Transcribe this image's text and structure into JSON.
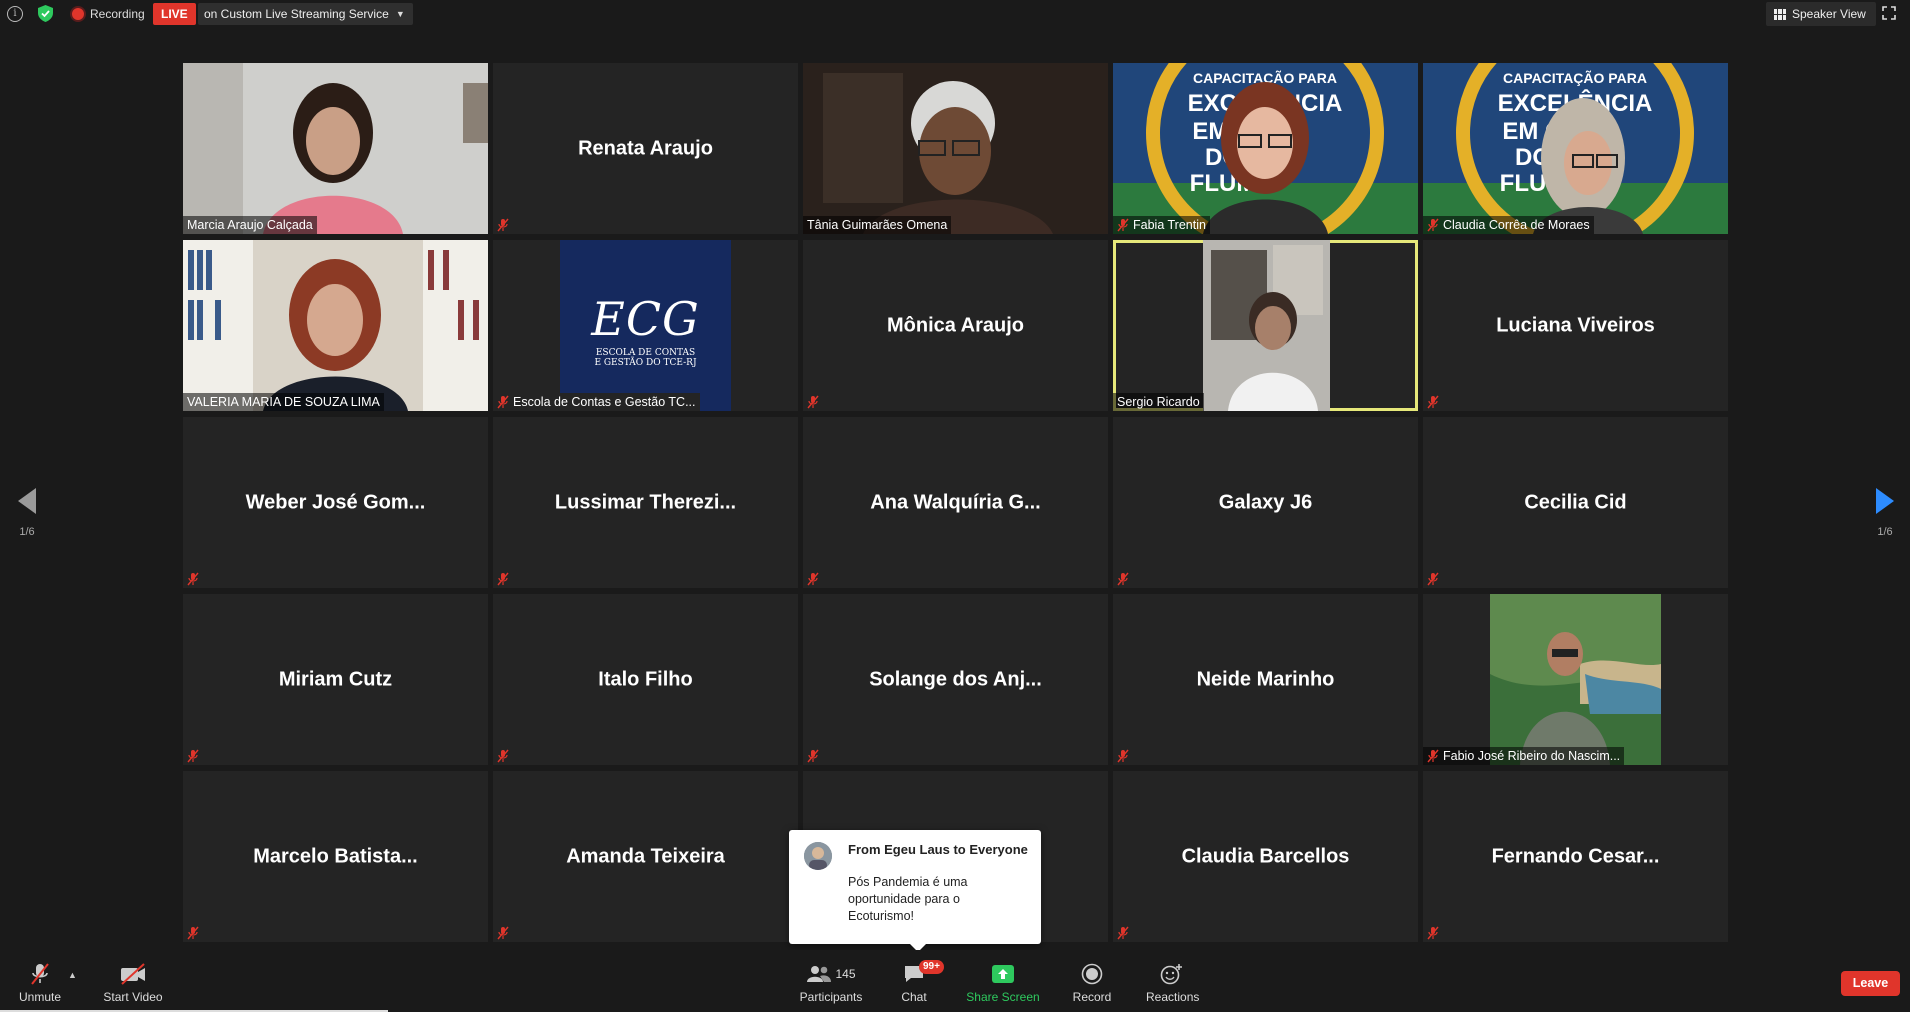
{
  "topbar": {
    "recording_label": "Recording",
    "live_label": "LIVE",
    "live_target": "on Custom Live Streaming Service",
    "speaker_view_label": "Speaker View"
  },
  "tiles": [
    {
      "name": "Marcia Araujo Calçada",
      "display": "video",
      "muted": false
    },
    {
      "name": "Renata Araujo",
      "display": "name",
      "muted": true
    },
    {
      "name": "Tânia Guimarães Omena",
      "display": "video",
      "muted": false
    },
    {
      "name": "Fabia Trentin",
      "display": "video",
      "muted": true
    },
    {
      "name": "Claudia Corrêa de Moraes",
      "display": "video",
      "muted": true
    },
    {
      "name": "VALERIA MARIA DE SOUZA LIMA",
      "display": "video",
      "muted": false
    },
    {
      "name": "Escola de Contas e Gestão TC...",
      "display": "logo",
      "muted": true
    },
    {
      "name": "Mônica Araujo",
      "display": "name",
      "muted": true
    },
    {
      "name": "Sergio Ricardo",
      "display": "video",
      "muted": false,
      "active": true
    },
    {
      "name": "Luciana Viveiros",
      "display": "name",
      "muted": true
    },
    {
      "name": "Weber José Gom...",
      "display": "name",
      "muted": true
    },
    {
      "name": "Lussimar Therezi...",
      "display": "name",
      "muted": true
    },
    {
      "name": "Ana Walquíria G...",
      "display": "name",
      "muted": true
    },
    {
      "name": "Galaxy J6",
      "display": "name",
      "muted": true
    },
    {
      "name": "Cecilia Cid",
      "display": "name",
      "muted": true
    },
    {
      "name": "Miriam Cutz",
      "display": "name",
      "muted": true
    },
    {
      "name": "Italo Filho",
      "display": "name",
      "muted": true
    },
    {
      "name": "Solange dos Anj...",
      "display": "name",
      "muted": true
    },
    {
      "name": "Neide Marinho",
      "display": "name",
      "muted": true
    },
    {
      "name": "Fabio José Ribeiro do Nascim...",
      "display": "video",
      "muted": true
    },
    {
      "name": "Marcelo Batista...",
      "display": "name",
      "muted": true
    },
    {
      "name": "Amanda Teixeira",
      "display": "name",
      "muted": true
    },
    {
      "name": "",
      "display": "name",
      "muted": false
    },
    {
      "name": "Claudia Barcellos",
      "display": "name",
      "muted": true
    },
    {
      "name": "Fernando Cesar...",
      "display": "name",
      "muted": true
    }
  ],
  "logo_tile": {
    "logo_text": "ECG",
    "logo_subtitle_1": "ESCOLA DE CONTAS",
    "logo_subtitle_2": "E GESTÃO DO TCE-RJ"
  },
  "banner": {
    "line1": "CAPACITAÇÃO PARA",
    "line2": "EXCELÊNCIA",
    "line3": "EM G",
    "line4": "DO",
    "line5": "FLUM"
  },
  "paging": {
    "left": "1/6",
    "right": "1/6"
  },
  "chat_popup": {
    "from": "From Egeu Laus to Everyone",
    "message": "Pós Pandemia é uma oportunidade para o Ecoturismo!"
  },
  "toolbar": {
    "unmute": "Unmute",
    "start_video": "Start Video",
    "participants": "Participants",
    "participants_count": "145",
    "chat": "Chat",
    "chat_badge": "99+",
    "share_screen": "Share Screen",
    "record": "Record",
    "reactions": "Reactions",
    "leave": "Leave"
  },
  "colors": {
    "live_red": "#e0352b",
    "active_speaker_border": "#e6e87a",
    "share_green": "#2ec95e",
    "page_arrow_blue": "#2d8cff"
  }
}
